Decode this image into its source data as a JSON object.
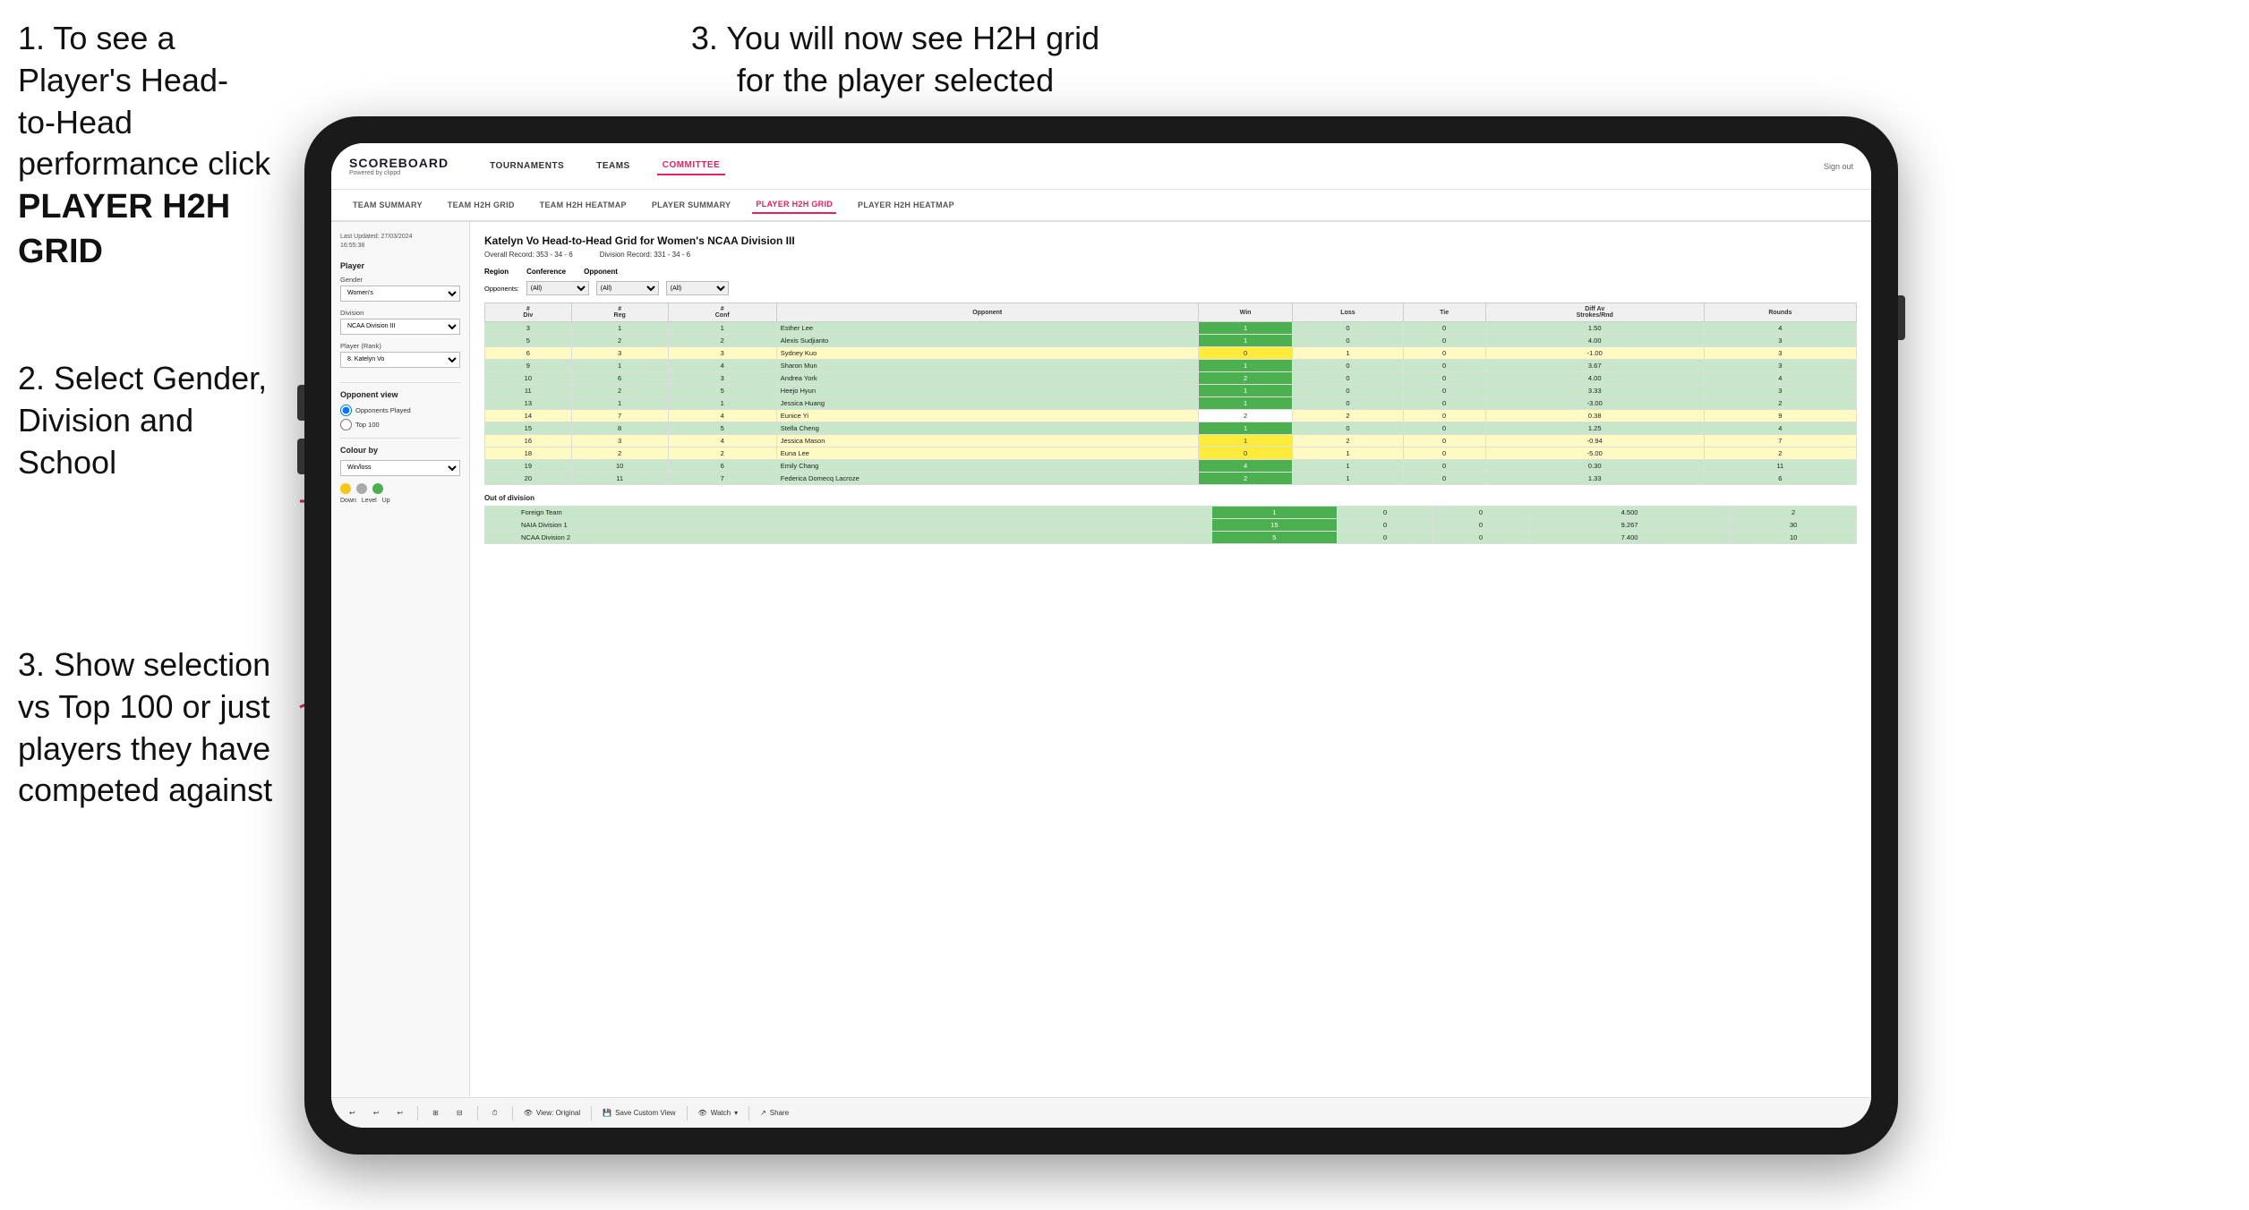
{
  "page": {
    "background": "#ffffff"
  },
  "instructions": {
    "step1_line1": "1. To see a Player's Head-",
    "step1_line2": "to-Head performance click",
    "step1_bold": "PLAYER H2H GRID",
    "step2_line1": "2. Select Gender,",
    "step2_line2": "Division and",
    "step2_line3": "School",
    "step3_top_line1": "3. You will now see H2H grid",
    "step3_top_line2": "for the player selected",
    "step3_bottom_line1": "3. Show selection",
    "step3_bottom_line2": "vs Top 100 or just",
    "step3_bottom_line3": "players they have",
    "step3_bottom_line4": "competed against"
  },
  "nav": {
    "logo": "SCOREBOARD",
    "logo_sub": "Powered by clippd",
    "items": [
      "TOURNAMENTS",
      "TEAMS",
      "COMMITTEE"
    ],
    "active_item": "COMMITTEE",
    "sign_in": "Sign out"
  },
  "sub_nav": {
    "items": [
      "TEAM SUMMARY",
      "TEAM H2H GRID",
      "TEAM H2H HEATMAP",
      "PLAYER SUMMARY",
      "PLAYER H2H GRID",
      "PLAYER H2H HEATMAP"
    ],
    "active": "PLAYER H2H GRID"
  },
  "sidebar": {
    "timestamp_label": "Last Updated: 27/03/2024",
    "timestamp_time": "16:55:38",
    "player_label": "Player",
    "gender_label": "Gender",
    "gender_value": "Women's",
    "division_label": "Division",
    "division_value": "NCAA Division III",
    "player_rank_label": "Player (Rank)",
    "player_rank_value": "8. Katelyn Vo",
    "opponent_view_label": "Opponent view",
    "radio_options": [
      "Opponents Played",
      "Top 100"
    ],
    "selected_radio": "Opponents Played",
    "colour_by_label": "Colour by",
    "colour_select_value": "Win/loss",
    "legend": {
      "down_label": "Down",
      "level_label": "Level",
      "up_label": "Up"
    }
  },
  "grid": {
    "title": "Katelyn Vo Head-to-Head Grid for Women's NCAA Division III",
    "overall_record_label": "Overall Record:",
    "overall_record": "353 - 34 - 6",
    "division_record_label": "Division Record:",
    "division_record": "331 - 34 - 6",
    "region_label": "Region",
    "conference_label": "Conference",
    "opponent_label": "Opponent",
    "opponents_label": "Opponents:",
    "filter_all": "(All)",
    "col_headers": [
      "#\nDiv",
      "#\nReg",
      "#\nConf",
      "Opponent",
      "Win",
      "Loss",
      "Tie",
      "Diff Av\nStrokes/Rnd",
      "Rounds"
    ],
    "rows": [
      {
        "div": 3,
        "reg": 1,
        "conf": 1,
        "opponent": "Esther Lee",
        "win": 1,
        "loss": 0,
        "tie": 0,
        "diff": "1.50",
        "rounds": 4,
        "color": "green"
      },
      {
        "div": 5,
        "reg": 2,
        "conf": 2,
        "opponent": "Alexis Sudjianto",
        "win": 1,
        "loss": 0,
        "tie": 0,
        "diff": "4.00",
        "rounds": 3,
        "color": "green"
      },
      {
        "div": 6,
        "reg": 3,
        "conf": 3,
        "opponent": "Sydney Kuo",
        "win": 0,
        "loss": 1,
        "tie": 0,
        "diff": "-1.00",
        "rounds": 3,
        "color": "yellow"
      },
      {
        "div": 9,
        "reg": 1,
        "conf": 4,
        "opponent": "Sharon Mun",
        "win": 1,
        "loss": 0,
        "tie": 0,
        "diff": "3.67",
        "rounds": 3,
        "color": "green"
      },
      {
        "div": 10,
        "reg": 6,
        "conf": 3,
        "opponent": "Andrea York",
        "win": 2,
        "loss": 0,
        "tie": 0,
        "diff": "4.00",
        "rounds": 4,
        "color": "green"
      },
      {
        "div": 11,
        "reg": 2,
        "conf": 5,
        "opponent": "Heejo Hyun",
        "win": 1,
        "loss": 0,
        "tie": 0,
        "diff": "3.33",
        "rounds": 3,
        "color": "green"
      },
      {
        "div": 13,
        "reg": 1,
        "conf": 1,
        "opponent": "Jessica Huang",
        "win": 1,
        "loss": 0,
        "tie": 0,
        "diff": "-3.00",
        "rounds": 2,
        "color": "green"
      },
      {
        "div": 14,
        "reg": 7,
        "conf": 4,
        "opponent": "Eunice Yi",
        "win": 2,
        "loss": 2,
        "tie": 0,
        "diff": "0.38",
        "rounds": 9,
        "color": "yellow"
      },
      {
        "div": 15,
        "reg": 8,
        "conf": 5,
        "opponent": "Stella Cheng",
        "win": 1,
        "loss": 0,
        "tie": 0,
        "diff": "1.25",
        "rounds": 4,
        "color": "green"
      },
      {
        "div": 16,
        "reg": 3,
        "conf": 4,
        "opponent": "Jessica Mason",
        "win": 1,
        "loss": 2,
        "tie": 0,
        "diff": "-0.94",
        "rounds": 7,
        "color": "yellow"
      },
      {
        "div": 18,
        "reg": 2,
        "conf": 2,
        "opponent": "Euna Lee",
        "win": 0,
        "loss": 1,
        "tie": 0,
        "diff": "-5.00",
        "rounds": 2,
        "color": "yellow"
      },
      {
        "div": 19,
        "reg": 10,
        "conf": 6,
        "opponent": "Emily Chang",
        "win": 4,
        "loss": 1,
        "tie": 0,
        "diff": "0.30",
        "rounds": 11,
        "color": "green"
      },
      {
        "div": 20,
        "reg": 11,
        "conf": 7,
        "opponent": "Federica Domecq Lacroze",
        "win": 2,
        "loss": 1,
        "tie": 0,
        "diff": "1.33",
        "rounds": 6,
        "color": "green"
      }
    ],
    "out_of_division_label": "Out of division",
    "out_of_division_rows": [
      {
        "team": "Foreign Team",
        "win": 1,
        "loss": 0,
        "tie": 0,
        "diff": "4.500",
        "rounds": 2,
        "color": "green"
      },
      {
        "team": "NAIA Division 1",
        "win": 15,
        "loss": 0,
        "tie": 0,
        "diff": "9.267",
        "rounds": 30,
        "color": "green"
      },
      {
        "team": "NCAA Division 2",
        "win": 5,
        "loss": 0,
        "tie": 0,
        "diff": "7.400",
        "rounds": 10,
        "color": "green"
      }
    ]
  },
  "toolbar": {
    "view_label": "View: Original",
    "save_label": "Save Custom View",
    "watch_label": "Watch",
    "share_label": "Share"
  }
}
